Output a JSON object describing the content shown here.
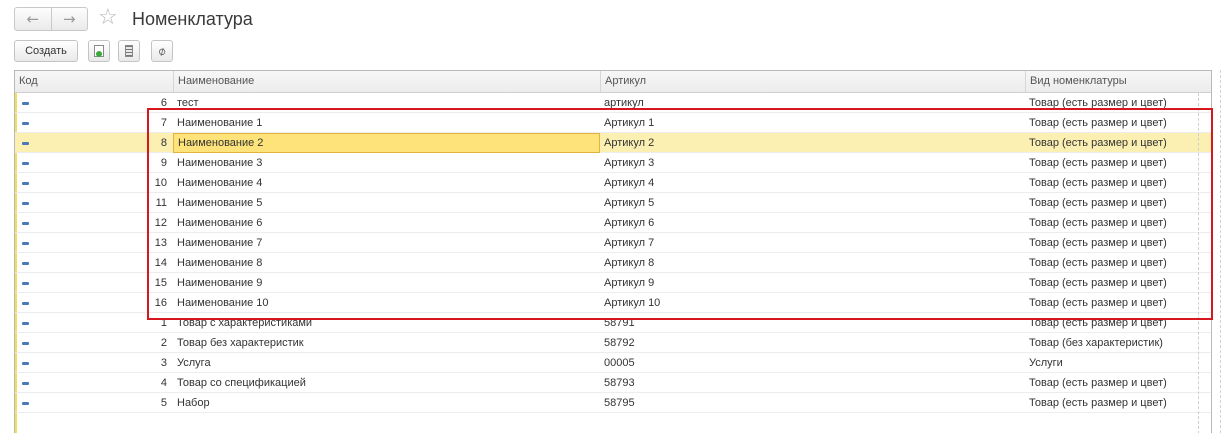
{
  "window": {
    "title": "Номенклатура",
    "back_icon": "arrow-left-icon",
    "forward_icon": "arrow-right-icon",
    "favorite_icon": "star-icon"
  },
  "toolbar": {
    "create_label": "Создать",
    "icons": [
      "copy-icon",
      "list-icon",
      "attach-icon"
    ]
  },
  "table": {
    "columns": [
      "Код",
      "Наименование",
      "Артикул",
      "Вид номенклатуры"
    ],
    "rows": [
      {
        "kod": "6",
        "name": "тест",
        "art": "артикул",
        "vid": "Товар (есть размер и цвет)"
      },
      {
        "kod": "7",
        "name": "Наименование 1",
        "art": "Артикул 1",
        "vid": "Товар (есть размер и цвет)"
      },
      {
        "kod": "8",
        "name": "Наименование 2",
        "art": "Артикул 2",
        "vid": "Товар (есть размер и цвет)",
        "selected": true
      },
      {
        "kod": "9",
        "name": "Наименование 3",
        "art": "Артикул 3",
        "vid": "Товар (есть размер и цвет)"
      },
      {
        "kod": "10",
        "name": "Наименование 4",
        "art": "Артикул 4",
        "vid": "Товар (есть размер и цвет)"
      },
      {
        "kod": "11",
        "name": "Наименование 5",
        "art": "Артикул 5",
        "vid": "Товар (есть размер и цвет)"
      },
      {
        "kod": "12",
        "name": "Наименование 6",
        "art": "Артикул 6",
        "vid": "Товар (есть размер и цвет)"
      },
      {
        "kod": "13",
        "name": "Наименование 7",
        "art": "Артикул 7",
        "vid": "Товар (есть размер и цвет)"
      },
      {
        "kod": "14",
        "name": "Наименование 8",
        "art": "Артикул 8",
        "vid": "Товар (есть размер и цвет)"
      },
      {
        "kod": "15",
        "name": "Наименование 9",
        "art": "Артикул 9",
        "vid": "Товар (есть размер и цвет)"
      },
      {
        "kod": "16",
        "name": "Наименование 10",
        "art": "Артикул 10",
        "vid": "Товар (есть размер и цвет)"
      },
      {
        "kod": "1",
        "name": "Товар с характеристиками",
        "art": "58791",
        "vid": "Товар (есть размер и цвет)"
      },
      {
        "kod": "2",
        "name": "Товар без характеристик",
        "art": "58792",
        "vid": "Товар (без характеристик)"
      },
      {
        "kod": "3",
        "name": "Услуга",
        "art": "00005",
        "vid": "Услуги"
      },
      {
        "kod": "4",
        "name": "Товар со спецификацией",
        "art": "58793",
        "vid": "Товар (есть размер и цвет)"
      },
      {
        "kod": "5",
        "name": "Набор",
        "art": "58795",
        "vid": "Товар (есть размер и цвет)"
      }
    ]
  },
  "colors": {
    "selected_row": "#fbefb1",
    "selected_cell": "#fde37a",
    "highlight_frame": "#d7161d",
    "row_marker": "#4a7ab8"
  }
}
